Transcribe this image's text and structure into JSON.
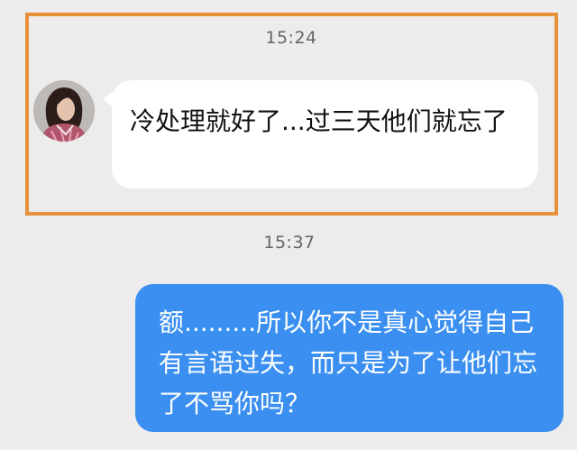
{
  "messages": [
    {
      "timestamp": "15:24",
      "direction": "incoming",
      "text": "冷处理就好了...过三天他们就忘了"
    },
    {
      "timestamp": "15:37",
      "direction": "outgoing",
      "text": "额.........所以你不是真心觉得自己有言语过失，而只是为了让他们忘了不骂你吗？"
    }
  ],
  "colors": {
    "background": "#ececec",
    "incoming_bubble": "#ffffff",
    "outgoing_bubble": "#3a8ff0",
    "highlight_border": "#e8913a",
    "timestamp_text": "#666666"
  },
  "icons": {
    "avatar": "user-avatar-photo"
  }
}
